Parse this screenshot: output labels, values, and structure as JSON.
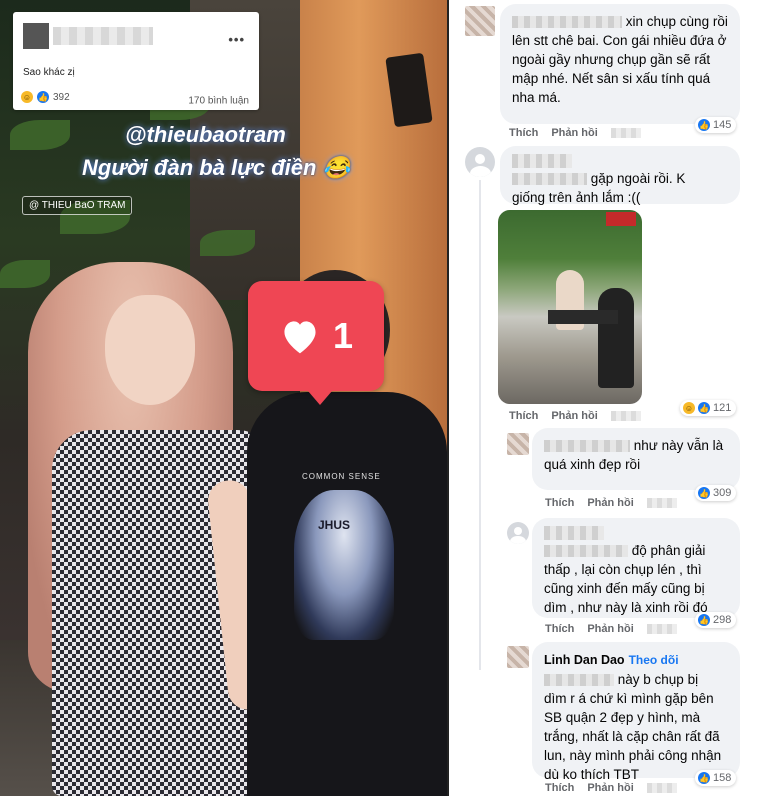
{
  "post_card": {
    "text": "Sao khác zị",
    "reactions_count": "392",
    "comments_count": "170 bình luận",
    "menu_icon": "more-dots-icon"
  },
  "story": {
    "mention": "@thieubaotram",
    "caption": "Người đàn bà lực điền 😂",
    "watermark": "@ THIEU BaO TRAM",
    "like_sticker_count": "1",
    "tee_text": "COMMON SENSE",
    "tee_print_label": "JHUS"
  },
  "comments": [
    {
      "text_line1": "xin chụp cùng rồi",
      "text_rest": "lên stt chê bai. Con gái nhiều đứa ở ngoài gầy nhưng chụp gần sẽ rất mập nhé. Nết sân si xấu tính quá nha má.",
      "like": "Thích",
      "reply": "Phản hồi",
      "reactions": "145"
    },
    {
      "text_line1": "gặp ngoài rồi. K",
      "text_rest": "giống trên ảnh lắm :((",
      "like": "Thích",
      "reply": "Phản hồi",
      "reactions": "121"
    },
    {
      "text_line1": "như này vẫn là",
      "text_rest": "quá xinh đẹp rồi",
      "like": "Thích",
      "reply": "Phản hồi",
      "reactions": "309"
    },
    {
      "text_line1": "độ phân giải",
      "text_rest": "thấp , lại còn chụp lén , thì cũng xinh đến mấy cũng bị dìm , như này là xinh rồi đó",
      "like": "Thích",
      "reply": "Phản hồi",
      "reactions": "298"
    },
    {
      "author": "Linh Dan Dao",
      "follow": "Theo dõi",
      "text_line1": "này b chụp bị",
      "text_rest": "dìm r á chứ kì mình gặp bên SB quận 2 đẹp y hình, mà trắng, nhất là cặp chân rất đã lun, này mình phải công nhận dù ko thích TBT",
      "like": "Thích",
      "reply": "Phản hồi",
      "reactions": "158"
    }
  ],
  "colors": {
    "accent": "#1877f2",
    "sticker": "#ef4654",
    "bubble": "#f0f2f5"
  }
}
